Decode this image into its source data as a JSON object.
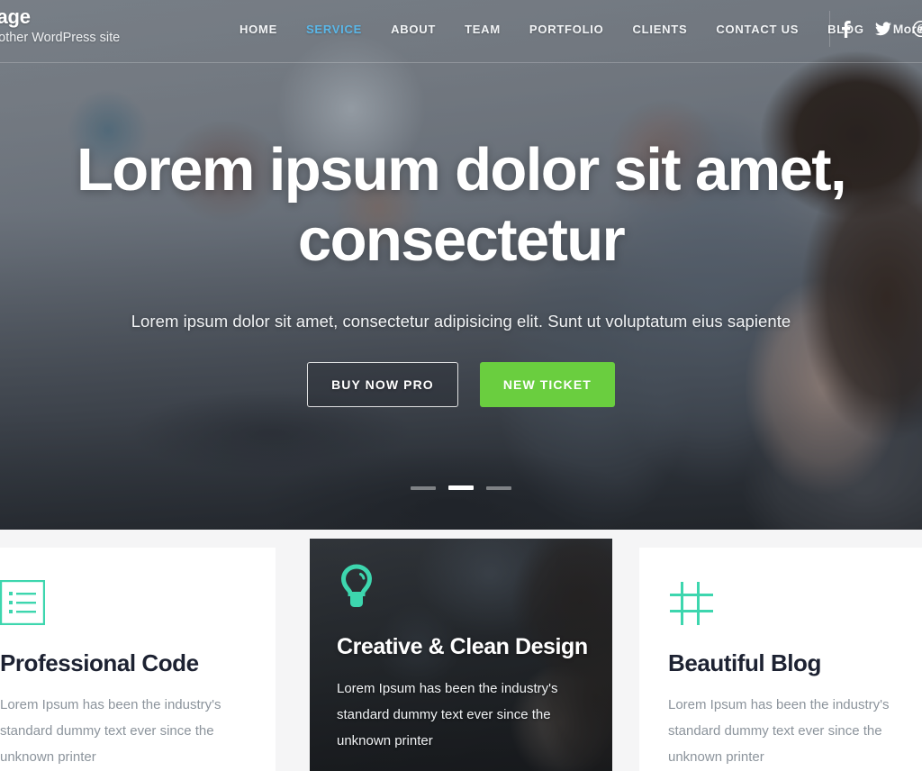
{
  "brand": {
    "title": "Page",
    "tagline": "another WordPress site"
  },
  "nav": {
    "items": [
      {
        "label": "HOME",
        "active": false
      },
      {
        "label": "SERVICE",
        "active": true
      },
      {
        "label": "ABOUT",
        "active": false
      },
      {
        "label": "TEAM",
        "active": false
      },
      {
        "label": "PORTFOLIO",
        "active": false
      },
      {
        "label": "CLIENTS",
        "active": false
      },
      {
        "label": "CONTACT US",
        "active": false
      },
      {
        "label": "BLOG",
        "active": false
      },
      {
        "label": "More",
        "active": false
      }
    ],
    "active_color": "#5ab7e8"
  },
  "social": {
    "items": [
      {
        "icon": "facebook-icon",
        "label": "Facebook"
      },
      {
        "icon": "twitter-icon",
        "label": "Twitter"
      },
      {
        "icon": "pinterest-icon",
        "label": "Pinterest"
      }
    ]
  },
  "hero": {
    "title": "Lorem ipsum dolor sit amet, consectetur",
    "subtitle": "Lorem ipsum dolor sit amet, consectetur adipisicing elit. Sunt ut voluptatum eius sapiente",
    "buttons": [
      {
        "label": "BUY NOW PRO",
        "style": "outline",
        "color": "#ffffff"
      },
      {
        "label": "NEW TICKET",
        "style": "solid",
        "color": "#6ace3f"
      }
    ],
    "slider": {
      "total": 3,
      "active_index": 2
    }
  },
  "features": {
    "accent_color": "#3dd6ae",
    "cards": [
      {
        "icon": "list-icon",
        "title": "Professional Code",
        "text": "Lorem Ipsum has been the industry's standard dummy text ever since the unknown printer",
        "theme": "light"
      },
      {
        "icon": "lightbulb-icon",
        "title": "Creative & Clean Design",
        "text": "Lorem Ipsum has been the industry's standard dummy text ever since the unknown printer",
        "theme": "dark"
      },
      {
        "icon": "hash-grid-icon",
        "title": "Beautiful Blog",
        "text": "Lorem Ipsum has been the industry's standard dummy text ever since the unknown printer",
        "theme": "light"
      }
    ]
  }
}
